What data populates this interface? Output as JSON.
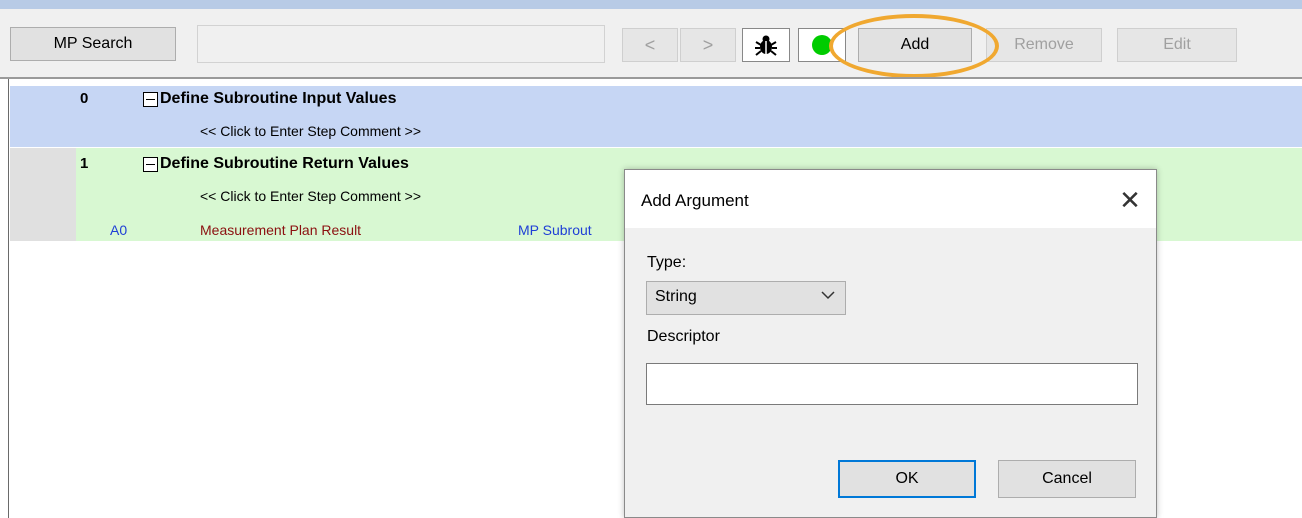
{
  "toolbar": {
    "mp_search_label": "MP Search",
    "search_value": "",
    "prev_label": "<",
    "next_label": ">",
    "debug_icon": "bug-icon",
    "status_icon": "green-dot-icon",
    "status_color": "#00cc00",
    "add_label": "Add",
    "remove_label": "Remove",
    "edit_label": "Edit"
  },
  "steps": [
    {
      "number": "0",
      "title": "Define Subroutine Input Values",
      "comment": "<< Click to Enter Step Comment >>"
    },
    {
      "number": "1",
      "title": "Define Subroutine Return Values",
      "comment": "<< Click to Enter Step Comment >>",
      "args": [
        {
          "id": "A0",
          "name": "Measurement Plan Result",
          "type": "MP Subrout"
        }
      ]
    }
  ],
  "dialog": {
    "title": "Add Argument",
    "close_icon": "close-icon",
    "type_label": "Type:",
    "type_value": "String",
    "descriptor_label": "Descriptor",
    "descriptor_value": "",
    "ok_label": "OK",
    "cancel_label": "Cancel"
  },
  "colors": {
    "highlight": "#f0a830",
    "row_blue": "#c6d6f4",
    "row_green": "#d8f8d2"
  }
}
